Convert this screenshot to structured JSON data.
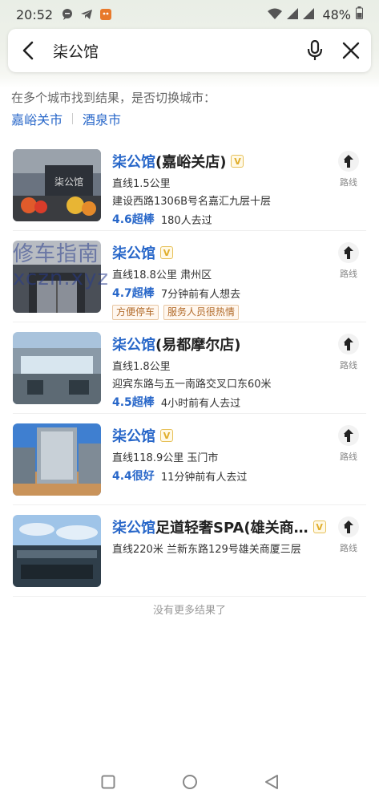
{
  "status": {
    "time": "20:52",
    "battery": "48%"
  },
  "search": {
    "query": "柒公馆"
  },
  "city_switch": {
    "hint": "在多个城市找到结果，是否切换城市：",
    "cities": [
      "嘉峪关市",
      "酒泉市"
    ]
  },
  "results": [
    {
      "title_highlight": "柒公馆",
      "title_rest": "(嘉峪关店)",
      "line2": "直线1.5公里",
      "line3": "建设西路1306B号名嘉汇九层十层",
      "score": "4.6超棒",
      "rating_extra": "180人去过",
      "tags": [],
      "route_label": "路线"
    },
    {
      "title_highlight": "柒公馆",
      "title_rest": "",
      "line2": "直线18.8公里  肃州区",
      "line3": "",
      "score": "4.7超棒",
      "rating_extra": "7分钟前有人想去",
      "tags": [
        "方便停车",
        "服务人员很热情"
      ],
      "route_label": "路线"
    },
    {
      "title_highlight": "柒公馆",
      "title_rest": "(易都摩尔店)",
      "line2": "直线1.8公里",
      "line3": "迎宾东路与五一南路交叉口东60米",
      "score": "4.5超棒",
      "rating_extra": "4小时前有人去过",
      "tags": [],
      "route_label": "路线"
    },
    {
      "title_highlight": "柒公馆",
      "title_rest": "",
      "line2": "直线118.9公里  玉门市",
      "line3": "",
      "score": "4.4很好",
      "rating_extra": "11分钟前有人去过",
      "tags": [],
      "route_label": "路线"
    },
    {
      "title_highlight": "柒公馆",
      "title_rest": "足道轻奢SPA(雄关商…",
      "line2": "直线220米  兰新东路129号雄关商厦三层",
      "line3": "",
      "score": "",
      "rating_extra": "",
      "tags": [],
      "route_label": "路线"
    }
  ],
  "watermark": {
    "line1": "修车指南",
    "line2": "xczn.xyz"
  },
  "footer": {
    "no_more": "没有更多结果了"
  },
  "colors": {
    "accent": "#2867c9",
    "tag": "#b26b2a",
    "badge": "#e0ad2b"
  }
}
